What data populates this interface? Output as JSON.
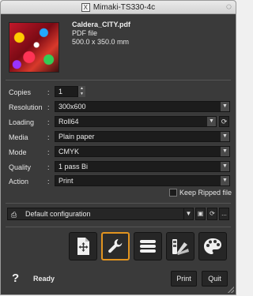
{
  "window": {
    "title": "Mimaki-TS330-4c",
    "app_icon": "X"
  },
  "file": {
    "name": "Caldera_CITY.pdf",
    "type": "PDF file",
    "size": "500.0 x 350.0 mm"
  },
  "settings": {
    "copies": {
      "label": "Copies",
      "value": "1"
    },
    "resolution": {
      "label": "Resolution",
      "value": "300x600"
    },
    "loading": {
      "label": "Loading",
      "value": "Roll64"
    },
    "media": {
      "label": "Media",
      "value": "Plain paper"
    },
    "mode": {
      "label": "Mode",
      "value": "CMYK"
    },
    "quality": {
      "label": "Quality",
      "value": "1 pass Bi"
    },
    "action": {
      "label": "Action",
      "value": "Print"
    },
    "colon": ":"
  },
  "keep_ripped": {
    "label": "Keep Ripped file",
    "checked": false
  },
  "configuration": {
    "value": "Default configuration",
    "more": "..."
  },
  "toolbar": {
    "tools": [
      {
        "name": "layout",
        "icon": "move-page-icon"
      },
      {
        "name": "settings",
        "icon": "wrench-icon",
        "active": true
      },
      {
        "name": "list",
        "icon": "list-icon"
      },
      {
        "name": "color-swatches",
        "icon": "swatches-icon"
      },
      {
        "name": "color-palette",
        "icon": "palette-icon"
      }
    ]
  },
  "footer": {
    "help": "?",
    "status": "Ready",
    "print_label": "Print",
    "quit_label": "Quit"
  },
  "colors": {
    "accent": "#e2941f",
    "panel": "#3a3a3a",
    "field": "#1c1c1c"
  }
}
